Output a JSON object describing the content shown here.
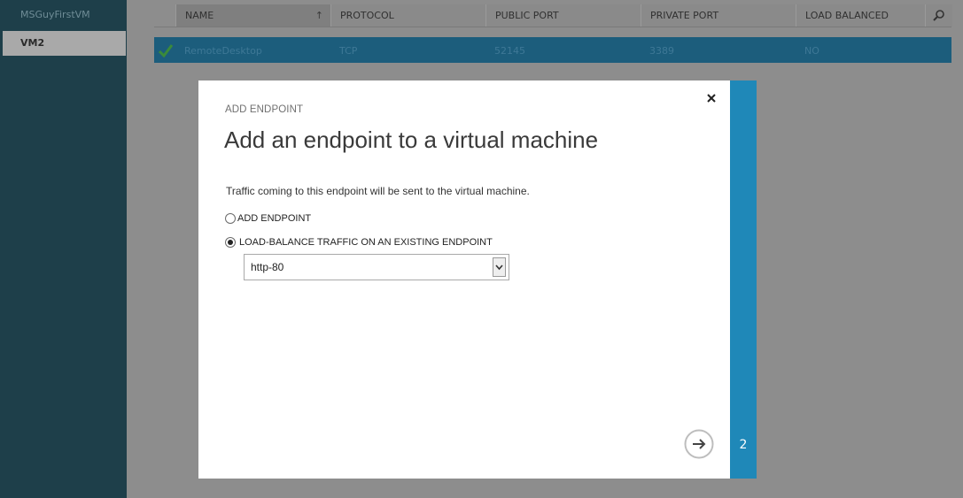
{
  "sidebar": {
    "items": [
      {
        "label": "MSGuyFirstVM"
      },
      {
        "label": "VM2"
      }
    ]
  },
  "table": {
    "headers": [
      "NAME",
      "PROTOCOL",
      "PUBLIC PORT",
      "PRIVATE PORT",
      "LOAD BALANCED"
    ],
    "sorted_column": "NAME",
    "rows": [
      {
        "name": "RemoteDesktop",
        "protocol": "TCP",
        "public_port": "52145",
        "private_port": "3389",
        "load_balanced": "NO",
        "status_icon": "check-icon"
      }
    ]
  },
  "dialog": {
    "eyebrow": "ADD ENDPOINT",
    "title": "Add an endpoint to a virtual machine",
    "description": "Traffic coming to this endpoint will be sent to the virtual machine.",
    "options": [
      {
        "label": "ADD ENDPOINT",
        "selected": false
      },
      {
        "label": "LOAD-BALANCE TRAFFIC ON AN EXISTING ENDPOINT",
        "selected": true
      }
    ],
    "endpoint_select": {
      "value": "http-80"
    },
    "step": "2"
  },
  "colors": {
    "sidebar_bg": "#1e3f4a",
    "row_selected": "#1c5d7c",
    "step_bar": "#1f88b8",
    "check": "#2e8b2e"
  }
}
